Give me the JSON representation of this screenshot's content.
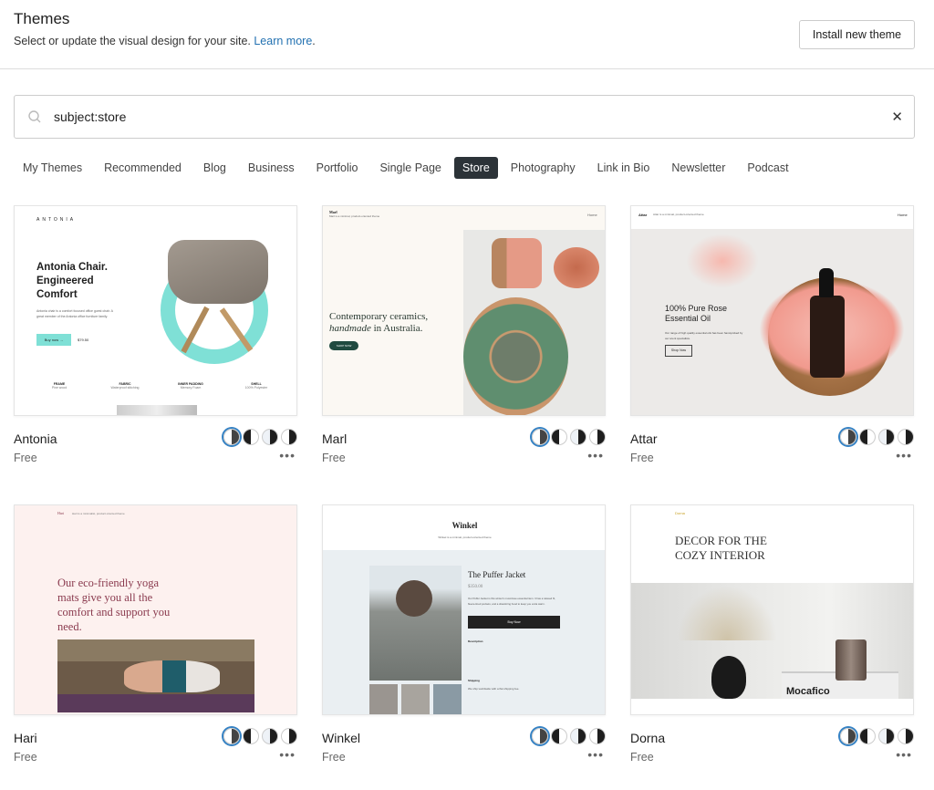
{
  "header": {
    "title": "Themes",
    "subtitle": "Select or update the visual design for your site.",
    "learn_more": "Learn more",
    "period": ".",
    "install_button": "Install new theme"
  },
  "search": {
    "value": "subject:store",
    "icon": "search-icon",
    "clear_icon": "close-icon",
    "clear_label": "✕"
  },
  "tabs": [
    {
      "label": "My Themes"
    },
    {
      "label": "Recommended"
    },
    {
      "label": "Blog"
    },
    {
      "label": "Business"
    },
    {
      "label": "Portfolio"
    },
    {
      "label": "Single Page"
    },
    {
      "label": "Store",
      "active": true
    },
    {
      "label": "Photography"
    },
    {
      "label": "Link in Bio"
    },
    {
      "label": "Newsletter"
    },
    {
      "label": "Podcast"
    }
  ],
  "themes": [
    {
      "name": "Antonia",
      "price": "Free",
      "preview": {
        "brand": "ANTONIA",
        "headline": "Antonia Chair. Engineered Comfort",
        "body": "Antonia chair is a comfort focused office guest chair. A great member of the Antonia office furniture family.",
        "button": "Buy now →",
        "amount": "$79.50",
        "specs": [
          [
            "FRAME",
            "Pine wood"
          ],
          [
            "FABRIC",
            "Waterproof stitching"
          ],
          [
            "INNER PADDING",
            "Memory Foam"
          ],
          [
            "SHELL",
            "100% Polyester"
          ]
        ]
      }
    },
    {
      "name": "Marl",
      "price": "Free",
      "preview": {
        "brand": "Marl",
        "tagline": "Marl is a minimal, product-oriented theme",
        "nav": "Home",
        "headline1": "Contemporary ceramics,",
        "headline2a": "handmade",
        "headline2b": " in Australia.",
        "button": "SHOP NOW"
      }
    },
    {
      "name": "Attar",
      "price": "Free",
      "preview": {
        "brand": "Attar",
        "tagline": "Attar is a minimal, product-oriented theme",
        "nav": "Home",
        "headline": "100% Pure Rose Essential Oil",
        "body": "Our range of high quality essential oils has been hand-picked by our scent specialists.",
        "button": "Shop Now"
      }
    },
    {
      "name": "Hari",
      "price": "Free",
      "preview": {
        "brand": "Hari",
        "tagline": "Hari is a minimalist, product oriented theme",
        "headline": "Our eco-friendly yoga mats give you all the comfort and support you need."
      }
    },
    {
      "name": "Winkel",
      "price": "Free",
      "preview": {
        "brand": "Winkel",
        "tagline": "Winkel is a minimal, product-oriented theme",
        "product": "The Puffer Jacket",
        "amount": "$350.00",
        "body": "Our Puffer Jacket is this winter's must-have essential item. It has a relaxed fit, fleece-lined pockets, and a drawstring hood to keep you extra warm.",
        "button": "Buy Now",
        "description": "Description",
        "shipping": "Shipping",
        "shipping_text": "We ship worldwide with a flat shipping fee."
      }
    },
    {
      "name": "Dorna",
      "price": "Free",
      "preview": {
        "brand": "Dorna",
        "headline1": "DECOR FOR THE",
        "headline2": "COZY INTERIOR",
        "book": "Mocafico"
      }
    }
  ],
  "colors": {
    "accent": "#3582c4",
    "link": "#2271b1",
    "active_tab": "#2c3338",
    "antonia_teal": "#7fe0d6",
    "marl_green": "#1f4a40",
    "hari_text": "#8a3a4e",
    "dorna_gold": "#c9a227"
  },
  "card_actions": {
    "more_label": "•••",
    "more_icon": "ellipsis-icon",
    "style_variations": 4,
    "selected_variation": 1
  }
}
